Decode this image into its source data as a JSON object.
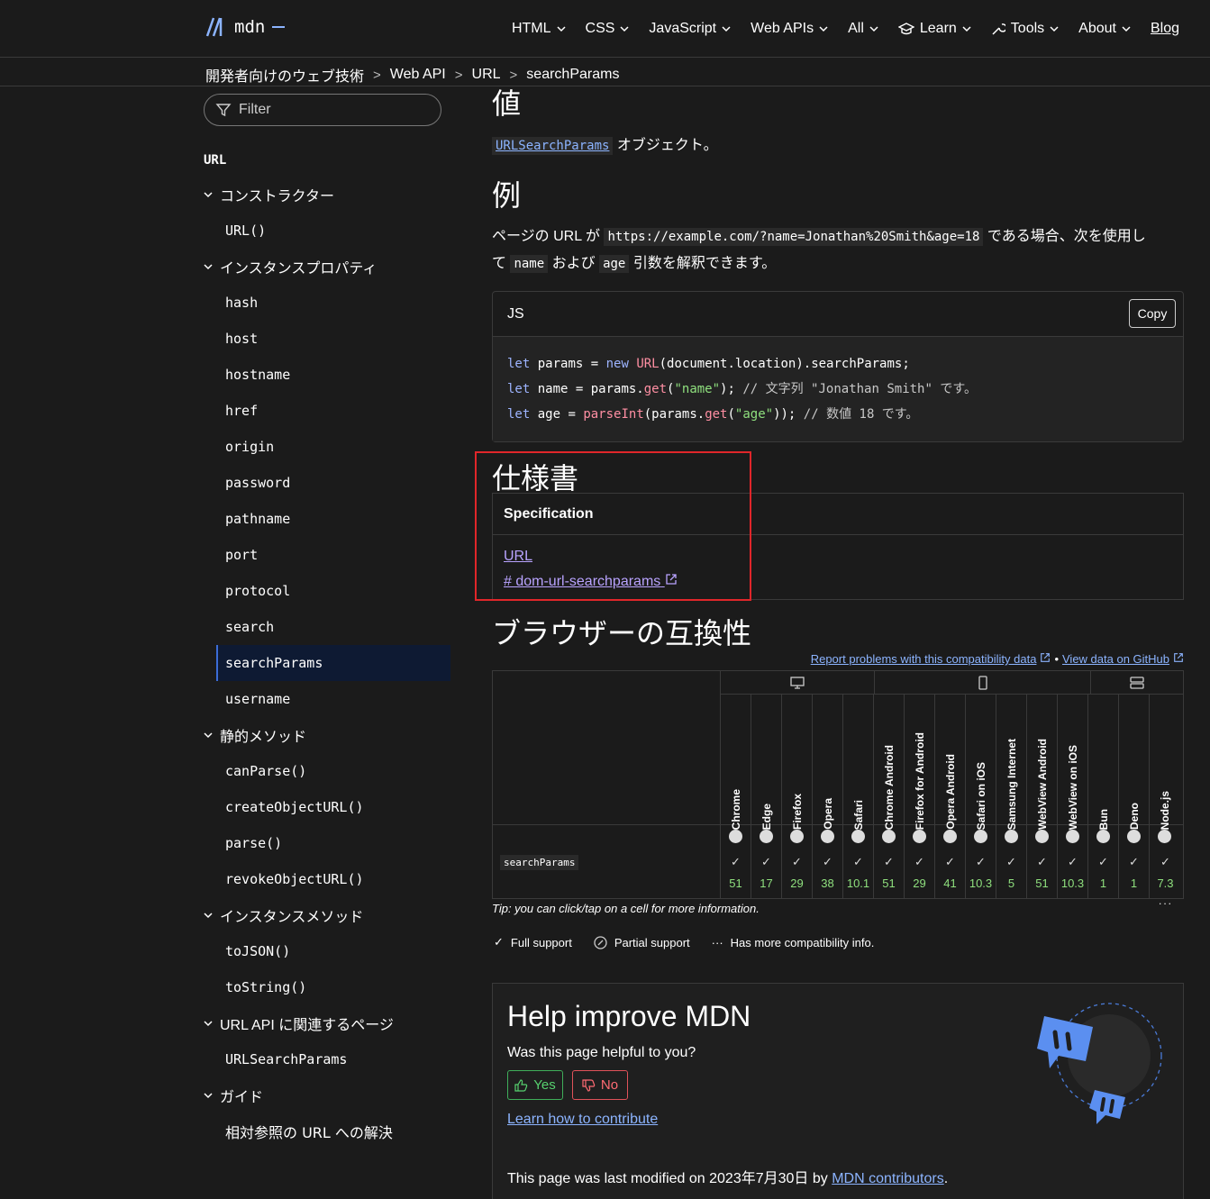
{
  "logo": {
    "text": "mdn"
  },
  "nav": {
    "items": [
      "HTML",
      "CSS",
      "JavaScript",
      "Web APIs",
      "All",
      "Learn",
      "Tools",
      "About"
    ],
    "blog": "Blog"
  },
  "breadcrumb": [
    "開発者向けのウェブ技術",
    "Web API",
    "URL",
    "searchParams"
  ],
  "sidebar": {
    "filter_placeholder": "Filter",
    "title": "URL",
    "groups": [
      {
        "label": "コンストラクター",
        "links": [
          "URL()"
        ]
      },
      {
        "label": "インスタンスプロパティ",
        "links": [
          "hash",
          "host",
          "hostname",
          "href",
          "origin",
          "password",
          "pathname",
          "port",
          "protocol",
          "search",
          "searchParams",
          "username"
        ]
      },
      {
        "label": "静的メソッド",
        "links": [
          "canParse()",
          "createObjectURL()",
          "parse()",
          "revokeObjectURL()"
        ]
      },
      {
        "label": "インスタンスメソッド",
        "links": [
          "toJSON()",
          "toString()"
        ]
      },
      {
        "label": "URL API に関連するページ",
        "links": [
          "URLSearchParams"
        ]
      },
      {
        "label": "ガイド",
        "links": [
          "相対参照の URL への解決"
        ]
      }
    ],
    "active": "searchParams"
  },
  "value_section": {
    "heading": "値",
    "link": "URLSearchParams",
    "text": " オブジェクト。"
  },
  "example_section": {
    "heading": "例",
    "p1": "ページの URL が ",
    "url_code": "https://example.com/?name=Jonathan%20Smith&age=18",
    "p2": " である場合、次を使用し",
    "p3": "て ",
    "name_code": "name",
    "p4": " および ",
    "age_code": "age",
    "p5": " 引数を解釈できます。",
    "code_lang": "JS",
    "copy_label": "Copy"
  },
  "spec_section": {
    "heading": "仕様書",
    "column": "Specification",
    "link1": "URL",
    "link2": "# dom-url-searchparams"
  },
  "compat_section": {
    "heading": "ブラウザーの互換性",
    "report_link": "Report problems with this compatibility data",
    "separator": "•",
    "github_link": "View data on GitHub",
    "feature": "searchParams",
    "browsers": [
      {
        "name": "Chrome",
        "version": "51"
      },
      {
        "name": "Edge",
        "version": "17"
      },
      {
        "name": "Firefox",
        "version": "29"
      },
      {
        "name": "Opera",
        "version": "38"
      },
      {
        "name": "Safari",
        "version": "10.1"
      },
      {
        "name": "Chrome Android",
        "version": "51"
      },
      {
        "name": "Firefox for Android",
        "version": "29"
      },
      {
        "name": "Opera Android",
        "version": "41"
      },
      {
        "name": "Safari on iOS",
        "version": "10.3"
      },
      {
        "name": "Samsung Internet",
        "version": "5"
      },
      {
        "name": "WebView Android",
        "version": "51"
      },
      {
        "name": "WebView on iOS",
        "version": "10.3"
      },
      {
        "name": "Bun",
        "version": "1"
      },
      {
        "name": "Deno",
        "version": "1"
      },
      {
        "name": "Node.js",
        "version": "7.3"
      }
    ],
    "tip": "Tip: you can click/tap on a cell for more information.",
    "legend": [
      "Full support",
      "Partial support",
      "Has more compatibility info."
    ]
  },
  "help": {
    "title": "Help improve MDN",
    "question": "Was this page helpful to you?",
    "yes": "Yes",
    "no": "No",
    "contribute": "Learn how to contribute",
    "lastmod_prefix": "This page was last modified on ",
    "lastmod_date": "2023年7月30日",
    "lastmod_by": " by ",
    "contributors": "MDN contributors",
    "period": "."
  },
  "colors": {
    "accent": "#8cb4ff",
    "highlight": "#e0262a",
    "support": "#8fe07e"
  }
}
